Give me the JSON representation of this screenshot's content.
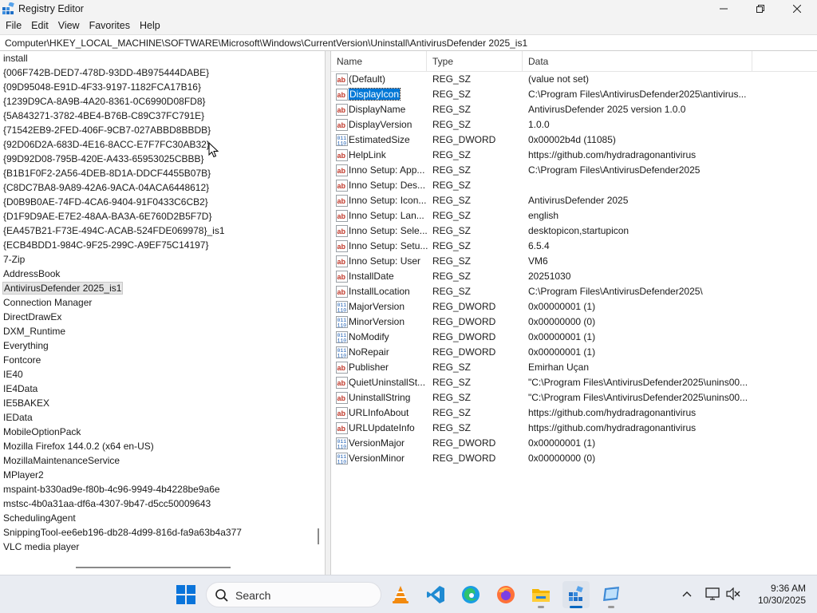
{
  "window": {
    "title": "Registry Editor"
  },
  "menu": [
    "File",
    "Edit",
    "View",
    "Favorites",
    "Help"
  ],
  "address": "Computer\\HKEY_LOCAL_MACHINE\\SOFTWARE\\Microsoft\\Windows\\CurrentVersion\\Uninstall\\AntivirusDefender 2025_is1",
  "tree": {
    "selected_index": 16,
    "items": [
      "install",
      "{006F742B-DED7-478D-93DD-4B975444DABE}",
      "{09D95048-E91D-4F33-9197-1182FCA17B16}",
      "{1239D9CA-8A9B-4A20-8361-0C6990D08FD8}",
      "{5A843271-3782-4BE4-B76B-C89C37FC791E}",
      "{71542EB9-2FED-406F-9CB7-027ABBD8BBDB}",
      "{92D06D2A-683D-4E16-8ACC-E7F7FC30AB32}",
      "{99D92D08-795B-420E-A433-65953025CBBB}",
      "{B1B1F0F2-2A56-4DEB-8D1A-DDCF4455B07B}",
      "{C8DC7BA8-9A89-42A6-9ACA-04ACA6448612}",
      "{D0B9B0AE-74FD-4CA6-9404-91F0433C6CB2}",
      "{D1F9D9AE-E7E2-48AA-BA3A-6E760D2B5F7D}",
      "{EA457B21-F73E-494C-ACAB-524FDE069978}_is1",
      "{ECB4BDD1-984C-9F25-299C-A9EF75C14197}",
      "7-Zip",
      "AddressBook",
      "AntivirusDefender 2025_is1",
      "Connection Manager",
      "DirectDrawEx",
      "DXM_Runtime",
      "Everything",
      "Fontcore",
      "IE40",
      "IE4Data",
      "IE5BAKEX",
      "IEData",
      "MobileOptionPack",
      "Mozilla Firefox 144.0.2 (x64 en-US)",
      "MozillaMaintenanceService",
      "MPlayer2",
      "mspaint-b330ad9e-f80b-4c96-9949-4b4228be9a6e",
      "mstsc-4b0a31aa-df6a-4307-9b47-d5cc50009643",
      "SchedulingAgent",
      "SnippingTool-ee6eb196-db28-4d99-816d-fa9a63b4a377",
      "VLC media player"
    ]
  },
  "list": {
    "columns": [
      "Name",
      "Type",
      "Data"
    ],
    "selected_index": 1,
    "rows": [
      {
        "icon": "string-value-icon",
        "name": "(Default)",
        "type": "REG_SZ",
        "data": "(value not set)"
      },
      {
        "icon": "string-value-icon",
        "name": "DisplayIcon",
        "type": "REG_SZ",
        "data": "C:\\Program Files\\AntivirusDefender2025\\antivirus..."
      },
      {
        "icon": "string-value-icon",
        "name": "DisplayName",
        "type": "REG_SZ",
        "data": "AntivirusDefender 2025 version 1.0.0"
      },
      {
        "icon": "string-value-icon",
        "name": "DisplayVersion",
        "type": "REG_SZ",
        "data": "1.0.0"
      },
      {
        "icon": "binary-value-icon",
        "name": "EstimatedSize",
        "type": "REG_DWORD",
        "data": "0x00002b4d (11085)"
      },
      {
        "icon": "string-value-icon",
        "name": "HelpLink",
        "type": "REG_SZ",
        "data": "https://github.com/hydradragonantivirus"
      },
      {
        "icon": "string-value-icon",
        "name": "Inno Setup: App...",
        "type": "REG_SZ",
        "data": "C:\\Program Files\\AntivirusDefender2025"
      },
      {
        "icon": "string-value-icon",
        "name": "Inno Setup: Des...",
        "type": "REG_SZ",
        "data": ""
      },
      {
        "icon": "string-value-icon",
        "name": "Inno Setup: Icon...",
        "type": "REG_SZ",
        "data": "AntivirusDefender 2025"
      },
      {
        "icon": "string-value-icon",
        "name": "Inno Setup: Lan...",
        "type": "REG_SZ",
        "data": "english"
      },
      {
        "icon": "string-value-icon",
        "name": "Inno Setup: Sele...",
        "type": "REG_SZ",
        "data": "desktopicon,startupicon"
      },
      {
        "icon": "string-value-icon",
        "name": "Inno Setup: Setu...",
        "type": "REG_SZ",
        "data": "6.5.4"
      },
      {
        "icon": "string-value-icon",
        "name": "Inno Setup: User",
        "type": "REG_SZ",
        "data": "VM6"
      },
      {
        "icon": "string-value-icon",
        "name": "InstallDate",
        "type": "REG_SZ",
        "data": "20251030"
      },
      {
        "icon": "string-value-icon",
        "name": "InstallLocation",
        "type": "REG_SZ",
        "data": "C:\\Program Files\\AntivirusDefender2025\\"
      },
      {
        "icon": "binary-value-icon",
        "name": "MajorVersion",
        "type": "REG_DWORD",
        "data": "0x00000001 (1)"
      },
      {
        "icon": "binary-value-icon",
        "name": "MinorVersion",
        "type": "REG_DWORD",
        "data": "0x00000000 (0)"
      },
      {
        "icon": "binary-value-icon",
        "name": "NoModify",
        "type": "REG_DWORD",
        "data": "0x00000001 (1)"
      },
      {
        "icon": "binary-value-icon",
        "name": "NoRepair",
        "type": "REG_DWORD",
        "data": "0x00000001 (1)"
      },
      {
        "icon": "string-value-icon",
        "name": "Publisher",
        "type": "REG_SZ",
        "data": "Emirhan Uçan"
      },
      {
        "icon": "string-value-icon",
        "name": "QuietUninstallSt...",
        "type": "REG_SZ",
        "data": "\"C:\\Program Files\\AntivirusDefender2025\\unins00..."
      },
      {
        "icon": "string-value-icon",
        "name": "UninstallString",
        "type": "REG_SZ",
        "data": "\"C:\\Program Files\\AntivirusDefender2025\\unins00..."
      },
      {
        "icon": "string-value-icon",
        "name": "URLInfoAbout",
        "type": "REG_SZ",
        "data": "https://github.com/hydradragonantivirus"
      },
      {
        "icon": "string-value-icon",
        "name": "URLUpdateInfo",
        "type": "REG_SZ",
        "data": "https://github.com/hydradragonantivirus"
      },
      {
        "icon": "binary-value-icon",
        "name": "VersionMajor",
        "type": "REG_DWORD",
        "data": "0x00000001 (1)"
      },
      {
        "icon": "binary-value-icon",
        "name": "VersionMinor",
        "type": "REG_DWORD",
        "data": "0x00000000 (0)"
      }
    ]
  },
  "taskbar": {
    "search_label": "Search",
    "clock_time": "9:36 AM",
    "clock_date": "10/30/2025",
    "apps": [
      "vlc-icon",
      "vscode-icon",
      "edge-icon",
      "firefox-icon",
      "file-explorer-icon",
      "registry-editor-icon",
      "remote-desktop-icon"
    ],
    "active_app": "registry-editor-icon"
  }
}
